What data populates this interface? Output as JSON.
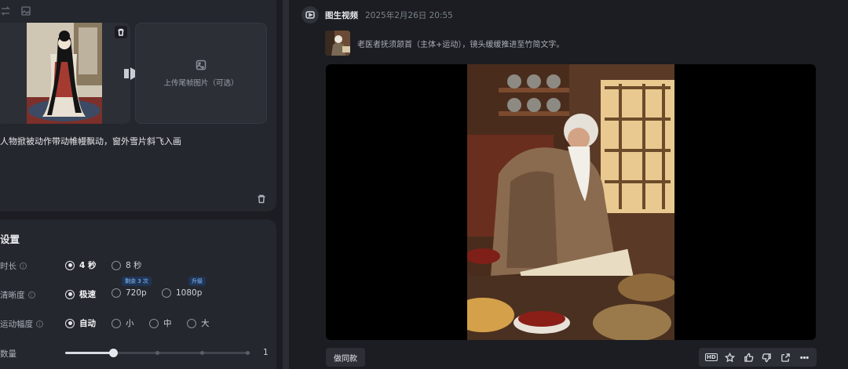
{
  "upload": {
    "last_frame_label": "上传尾帧图片（可选）"
  },
  "prompt_text": "人物掀被动作带动帷幔飘动，窗外雪片斜飞入画",
  "settings": {
    "title": "设置",
    "duration": {
      "label": "时长",
      "options": [
        "4 秒",
        "8 秒"
      ],
      "selected": "4 秒"
    },
    "clarity": {
      "label": "清晰度",
      "options": [
        "极速",
        "720p",
        "1080p"
      ],
      "selected": "极速",
      "badge_720p": "剩余 3 次",
      "badge_1080p": "升级"
    },
    "motion": {
      "label": "运动幅度",
      "options": [
        "自动",
        "小",
        "中",
        "大"
      ],
      "selected": "自动"
    },
    "quantity": {
      "label": "数量",
      "value": "1"
    }
  },
  "message": {
    "title": "图生视频",
    "time": "2025年2月26日 20:55",
    "prompt": "老医者抚须颔首（主体+运动），镜头缓缓推进至竹简文字。",
    "same_button": "做同款"
  },
  "icons": [
    "swap-icon",
    "image-icon",
    "trash-icon",
    "play-arrow-icon",
    "upload-image-icon",
    "info-icon",
    "video-avatar-icon",
    "hd-icon",
    "star-icon",
    "thumbs-up-icon",
    "thumbs-down-icon",
    "share-icon",
    "more-icon"
  ],
  "colors": {
    "background": "#1b1d22",
    "panel": "#24272d",
    "accent_badge": "#8ec1ff"
  }
}
